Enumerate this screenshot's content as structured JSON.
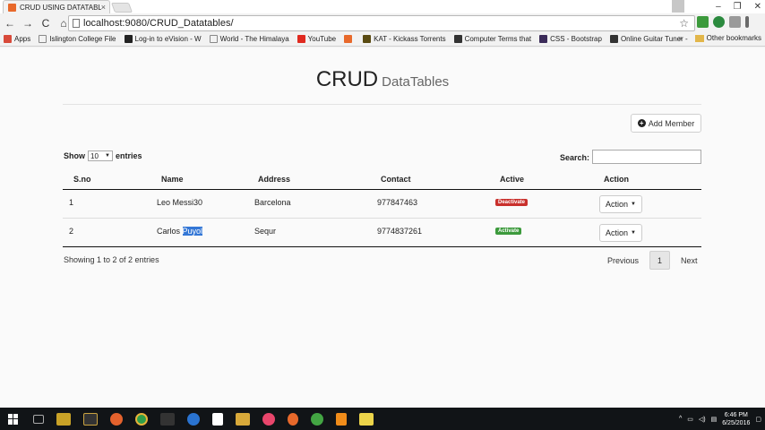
{
  "browser": {
    "tab_title": "CRUD USING DATATABLE",
    "tab_close": "×",
    "url": "localhost:9080/CRUD_Datatables/",
    "window_controls": {
      "minimize": "–",
      "maximize": "❐",
      "close": "✕"
    },
    "nav": {
      "back": "←",
      "forward": "→",
      "reload": "C",
      "home": "⌂"
    },
    "star": "☆",
    "bookmarks": [
      {
        "label": "Apps",
        "color": "#d84a3a"
      },
      {
        "label": "Islington College File",
        "color": "#888888"
      },
      {
        "label": "Log-in to eVision - W",
        "color": "#222222"
      },
      {
        "label": "World - The Himalaya",
        "color": "#888888"
      },
      {
        "label": "YouTube",
        "color": "#e02a20"
      },
      {
        "label": "",
        "color": "#e8692b"
      },
      {
        "label": "KAT - Kickass Torrents",
        "color": "#5a4b12"
      },
      {
        "label": "Computer Terms that",
        "color": "#333333"
      },
      {
        "label": "CSS - Bootstrap",
        "color": "#3b2b59"
      },
      {
        "label": "Online Guitar Tuner -",
        "color": "#333333"
      }
    ],
    "bookmarks_more": "»",
    "other_bookmarks": "Other bookmarks"
  },
  "page": {
    "title": "CRUD",
    "subtitle": "DataTables",
    "add_button": "Add Member",
    "show_label": "Show",
    "entries_label": "entries",
    "page_length": "10",
    "search_label": "Search:",
    "search_value": "",
    "columns": [
      "S.no",
      "Name",
      "Address",
      "Contact",
      "Active",
      "Action"
    ],
    "rows": [
      {
        "sno": "1",
        "name_first": "Leo Messi30",
        "name_selected": "",
        "address": "Barcelona",
        "contact": "977847463",
        "status": "Deactivate",
        "status_color": "#c9302c",
        "action": "Action"
      },
      {
        "sno": "2",
        "name_first": "Carlos ",
        "name_selected": "Puyol",
        "address": "Sequr",
        "contact": "9774837261",
        "status": "Activate",
        "status_color": "#3c9a3c",
        "action": "Action"
      }
    ],
    "info": "Showing 1 to 2 of 2 entries",
    "pager": {
      "previous": "Previous",
      "current": "1",
      "next": "Next"
    }
  },
  "taskbar": {
    "time": "6:46 PM",
    "date": "6/25/2016",
    "apps": [
      "#c9a227",
      "#e6e6e6",
      "#caa340",
      "#e4622d",
      "#2f9f4a",
      "#333333",
      "#2a73d0",
      "#ffffff",
      "#d8a93a",
      "#e9466c",
      "#e8692b",
      "#43a543",
      "#f08c1a",
      "#ecd44a"
    ]
  },
  "colors": {
    "accent": "#3477d6",
    "danger": "#c9302c",
    "success": "#3c9a3c"
  }
}
